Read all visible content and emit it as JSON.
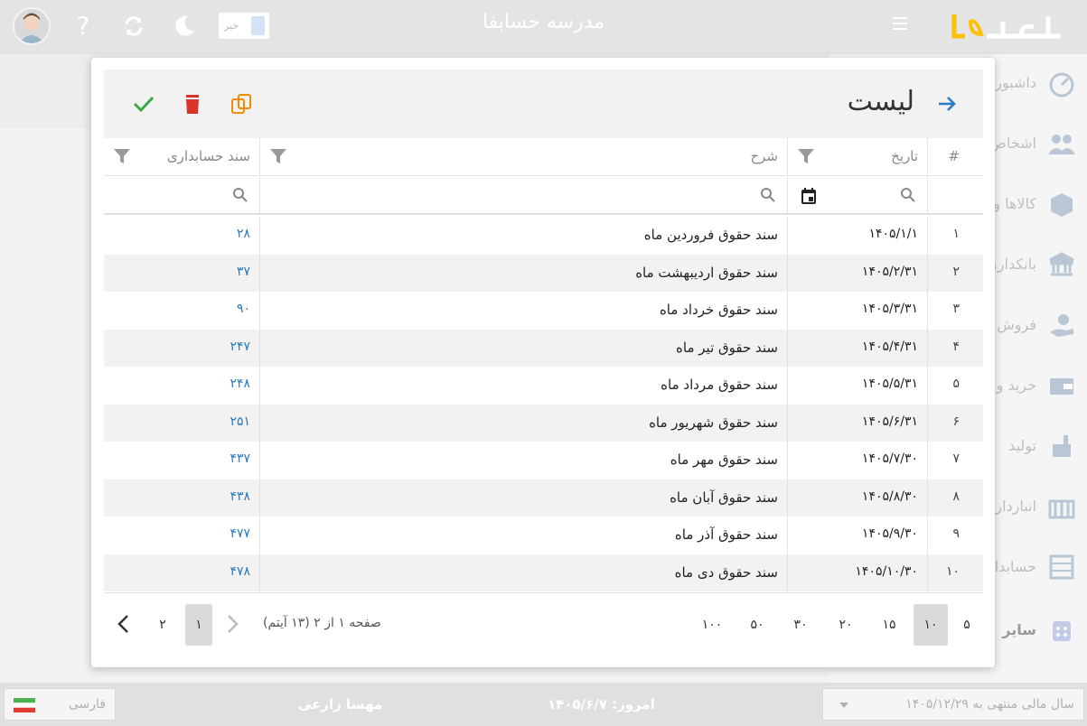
{
  "header": {
    "title": "مدرسه حسابفا",
    "switch_label": "خیر",
    "logo_text": "حساب فا"
  },
  "sidebar": {
    "items": [
      {
        "label": "داشبورد",
        "icon": "speedometer-icon"
      },
      {
        "label": "اشخاص",
        "icon": "people-icon"
      },
      {
        "label": "کالاها و",
        "icon": "box-icon"
      },
      {
        "label": "بانکداری",
        "icon": "bank-icon"
      },
      {
        "label": "فروش",
        "icon": "sales-icon"
      },
      {
        "label": "خرید و",
        "icon": "wallet-icon"
      },
      {
        "label": "تولید",
        "icon": "factory-icon"
      },
      {
        "label": "انبارداری",
        "icon": "warehouse-icon"
      },
      {
        "label": "حسابدا",
        "icon": "abacus-icon"
      },
      {
        "label": "سایر",
        "icon": "other-icon"
      }
    ]
  },
  "modal": {
    "title": "لیست",
    "columns": {
      "index": "#",
      "date": "تاریخ",
      "description": "شرح",
      "document": "سند حسابداری"
    },
    "rows": [
      {
        "idx": "۱",
        "date": "۱۴۰۵/۱/۱",
        "desc": "سند حقوق فروردین ماه",
        "doc": "۲۸"
      },
      {
        "idx": "۲",
        "date": "۱۴۰۵/۲/۳۱",
        "desc": "سند حقوق اردیبهشت ماه",
        "doc": "۳۷"
      },
      {
        "idx": "۳",
        "date": "۱۴۰۵/۳/۳۱",
        "desc": "سند حقوق خرداد ماه",
        "doc": "۹۰"
      },
      {
        "idx": "۴",
        "date": "۱۴۰۵/۴/۳۱",
        "desc": "سند حقوق تیر ماه",
        "doc": "۲۴۷"
      },
      {
        "idx": "۵",
        "date": "۱۴۰۵/۵/۳۱",
        "desc": "سند حقوق مرداد ماه",
        "doc": "۲۴۸"
      },
      {
        "idx": "۶",
        "date": "۱۴۰۵/۶/۳۱",
        "desc": "سند حقوق شهریور ماه",
        "doc": "۲۵۱"
      },
      {
        "idx": "۷",
        "date": "۱۴۰۵/۷/۳۰",
        "desc": "سند حقوق مهر ماه",
        "doc": "۴۳۷"
      },
      {
        "idx": "۸",
        "date": "۱۴۰۵/۸/۳۰",
        "desc": "سند حقوق آبان ماه",
        "doc": "۴۳۸"
      },
      {
        "idx": "۹",
        "date": "۱۴۰۵/۹/۳۰",
        "desc": "سند حقوق آذر ماه",
        "doc": "۴۷۷"
      },
      {
        "idx": "۱۰",
        "date": "۱۴۰۵/۱۰/۳۰",
        "desc": "سند حقوق دی ماه",
        "doc": "۴۷۸"
      }
    ],
    "pager": {
      "page_sizes": [
        "۵",
        "۱۰",
        "۱۵",
        "۲۰",
        "۳۰",
        "۵۰",
        "۱۰۰"
      ],
      "selected_page_size": "۱۰",
      "info": "صفحه ۱ از ۲ (۱۳ آیتم)",
      "pages": [
        "۱",
        "۲"
      ],
      "current_page": "۱"
    }
  },
  "statusbar": {
    "language": "فارسی",
    "user": "مهسا زارعی",
    "today": "امروز: ۱۴۰۵/۶/۷",
    "fiscal_year": "سال مالی منتهی به ۱۴۰۵/۱۲/۲۹"
  },
  "colors": {
    "accent": "#2a7bc1",
    "delete": "#d9342b",
    "confirm": "#3aa845",
    "copy": "#f08c00",
    "logo": "#ffc107"
  }
}
